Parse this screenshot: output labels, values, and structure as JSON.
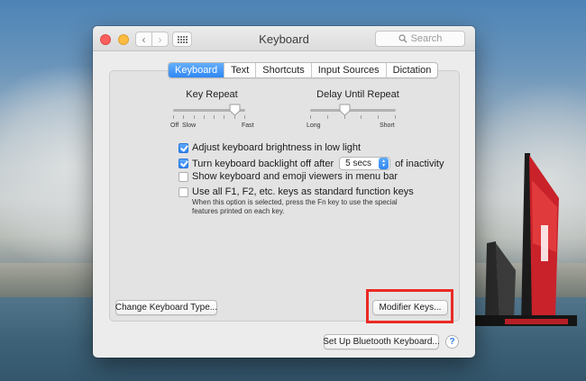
{
  "window": {
    "title": "Keyboard",
    "search_placeholder": "Search"
  },
  "tabs": [
    {
      "label": "Keyboard",
      "active": true
    },
    {
      "label": "Text",
      "active": false
    },
    {
      "label": "Shortcuts",
      "active": false
    },
    {
      "label": "Input Sources",
      "active": false
    },
    {
      "label": "Dictation",
      "active": false
    }
  ],
  "key_repeat": {
    "title": "Key Repeat",
    "labels": [
      "Off",
      "Slow",
      "Fast"
    ],
    "ticks": 8,
    "value_fraction": 0.86
  },
  "delay_until_repeat": {
    "title": "Delay Until Repeat",
    "labels": [
      "Long",
      "Short"
    ],
    "ticks": 6,
    "value_fraction": 0.4
  },
  "options": {
    "adjust_brightness": {
      "label": "Adjust keyboard brightness in low light",
      "checked": true
    },
    "backlight_off": {
      "label_before": "Turn keyboard backlight off after",
      "value": "5 secs",
      "label_after": "of inactivity",
      "checked": true
    },
    "show_viewers": {
      "label": "Show keyboard and emoji viewers in menu bar",
      "checked": false
    },
    "function_keys": {
      "label": "Use all F1, F2, etc. keys as standard function keys",
      "checked": false,
      "note_line1": "When this option is selected, press the Fn key to use the special",
      "note_line2": "features printed on each key."
    }
  },
  "buttons": {
    "change_type": "Change Keyboard Type...",
    "modifier_keys": "Modifier Keys...",
    "bluetooth": "Set Up Bluetooth Keyboard...",
    "help": "?"
  },
  "colors": {
    "accent": "#2f88f5",
    "highlight": "#ea2a24"
  }
}
